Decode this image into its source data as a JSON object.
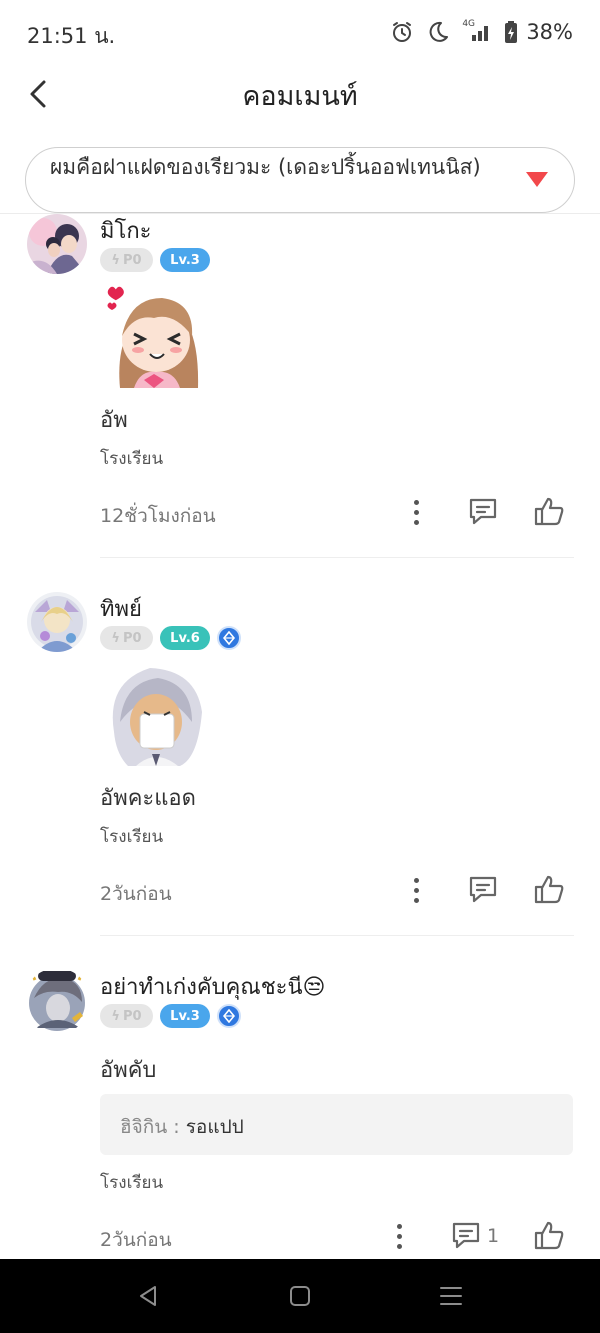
{
  "status_bar": {
    "time": "21:51 น.",
    "network": "4G",
    "battery_percent": "38%"
  },
  "header": {
    "title": "คอมเมนท์"
  },
  "series_select": {
    "value": "ผมคือฝาแฝดของเรียวมะ (เดอะปริ้นออฟเทนนิส)",
    "arrow_color": "#f2484b"
  },
  "comments": [
    {
      "username": "มิโกะ",
      "points": "P0",
      "level": "Lv.3",
      "has_sticker": true,
      "text": "อัพ",
      "tag": "โรงเรียน",
      "time": "12ชั่วโมงก่อน"
    },
    {
      "username": "ทิพย์",
      "points": "P0",
      "level": "Lv.6",
      "verified": true,
      "has_sticker": true,
      "text": "อัพคะแอด",
      "tag": "โรงเรียน",
      "time": "2วันก่อน"
    },
    {
      "username": "อย่าทำเก่งคับคุณชะนี😒",
      "points": "P0",
      "level": "Lv.3",
      "verified": true,
      "text": "อัพคับ",
      "reply": {
        "name": "ฮิจิกิน : ",
        "text": "รอแปป"
      },
      "tag": "โรงเรียน",
      "time": "2วันก่อน",
      "reply_count": "1"
    }
  ],
  "colors": {
    "lv_blue": "#4aa6ec",
    "lv_teal": "#39c2b9",
    "verified": "#2f78e0"
  }
}
